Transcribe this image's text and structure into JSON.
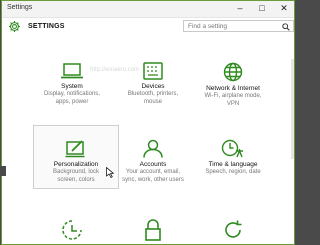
{
  "window": {
    "title": "Settings"
  },
  "header": {
    "title": "SETTINGS"
  },
  "search": {
    "placeholder": "Find a setting"
  },
  "watermark": "http://winaero.com",
  "tiles": [
    {
      "name": "System",
      "desc1": "Display, notifications,",
      "desc2": "apps, power",
      "icon": "laptop-icon"
    },
    {
      "name": "Devices",
      "desc1": "Bluetooth, printers,",
      "desc2": "mouse",
      "icon": "keyboard-icon"
    },
    {
      "name": "Network & Internet",
      "desc1": "Wi-Fi, airplane mode,",
      "desc2": "VPN",
      "icon": "globe-icon"
    },
    {
      "name": "Personalization",
      "desc1": "Background, lock",
      "desc2": "screen, colors",
      "icon": "paint-icon"
    },
    {
      "name": "Accounts",
      "desc1": "Your account, email,",
      "desc2": "sync, work, other users",
      "icon": "person-icon"
    },
    {
      "name": "Time & language",
      "desc1": "Speech, region, date",
      "desc2": "",
      "icon": "clock-icon"
    },
    {
      "name": "",
      "desc1": "",
      "desc2": "",
      "icon": "ease-of-access-icon"
    },
    {
      "name": "",
      "desc1": "",
      "desc2": "",
      "icon": "lock-icon"
    },
    {
      "name": "",
      "desc1": "",
      "desc2": "",
      "icon": "update-icon"
    }
  ],
  "colors": {
    "accent": "#2e8b1f",
    "border": "#6a9a3a"
  }
}
